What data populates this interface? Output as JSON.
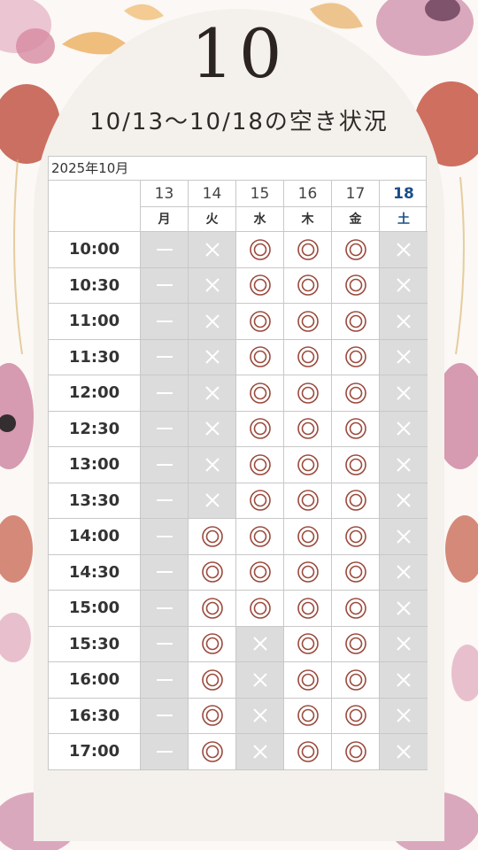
{
  "month_number": "10",
  "title": "10/13～10/18の空き状況",
  "table": {
    "caption": "2025年10月",
    "days": [
      {
        "date": "13",
        "weekday": "月",
        "saturday": false
      },
      {
        "date": "14",
        "weekday": "火",
        "saturday": false
      },
      {
        "date": "15",
        "weekday": "水",
        "saturday": false
      },
      {
        "date": "16",
        "weekday": "木",
        "saturday": false
      },
      {
        "date": "17",
        "weekday": "金",
        "saturday": false
      },
      {
        "date": "18",
        "weekday": "土",
        "saturday": true
      }
    ],
    "legend": {
      "available": "◎",
      "full": "×",
      "closed": "—"
    },
    "rows": [
      {
        "time": "10:00",
        "cells": [
          "—",
          "×",
          "◎",
          "◎",
          "◎",
          "×"
        ]
      },
      {
        "time": "10:30",
        "cells": [
          "—",
          "×",
          "◎",
          "◎",
          "◎",
          "×"
        ]
      },
      {
        "time": "11:00",
        "cells": [
          "—",
          "×",
          "◎",
          "◎",
          "◎",
          "×"
        ]
      },
      {
        "time": "11:30",
        "cells": [
          "—",
          "×",
          "◎",
          "◎",
          "◎",
          "×"
        ]
      },
      {
        "time": "12:00",
        "cells": [
          "—",
          "×",
          "◎",
          "◎",
          "◎",
          "×"
        ]
      },
      {
        "time": "12:30",
        "cells": [
          "—",
          "×",
          "◎",
          "◎",
          "◎",
          "×"
        ]
      },
      {
        "time": "13:00",
        "cells": [
          "—",
          "×",
          "◎",
          "◎",
          "◎",
          "×"
        ]
      },
      {
        "time": "13:30",
        "cells": [
          "—",
          "×",
          "◎",
          "◎",
          "◎",
          "×"
        ]
      },
      {
        "time": "14:00",
        "cells": [
          "—",
          "◎",
          "◎",
          "◎",
          "◎",
          "×"
        ]
      },
      {
        "time": "14:30",
        "cells": [
          "—",
          "◎",
          "◎",
          "◎",
          "◎",
          "×"
        ]
      },
      {
        "time": "15:00",
        "cells": [
          "—",
          "◎",
          "◎",
          "◎",
          "◎",
          "×"
        ]
      },
      {
        "time": "15:30",
        "cells": [
          "—",
          "◎",
          "×",
          "◎",
          "◎",
          "×"
        ]
      },
      {
        "time": "16:00",
        "cells": [
          "—",
          "◎",
          "×",
          "◎",
          "◎",
          "×"
        ]
      },
      {
        "time": "16:30",
        "cells": [
          "—",
          "◎",
          "×",
          "◎",
          "◎",
          "×"
        ]
      },
      {
        "time": "17:00",
        "cells": [
          "—",
          "◎",
          "×",
          "◎",
          "◎",
          "×"
        ]
      }
    ]
  },
  "colors": {
    "available_ring": "#9a4a3c",
    "unavailable_mark": "#ffffff",
    "unavailable_bg": "#dcdcdc",
    "saturday_text": "#1a4e8a"
  }
}
